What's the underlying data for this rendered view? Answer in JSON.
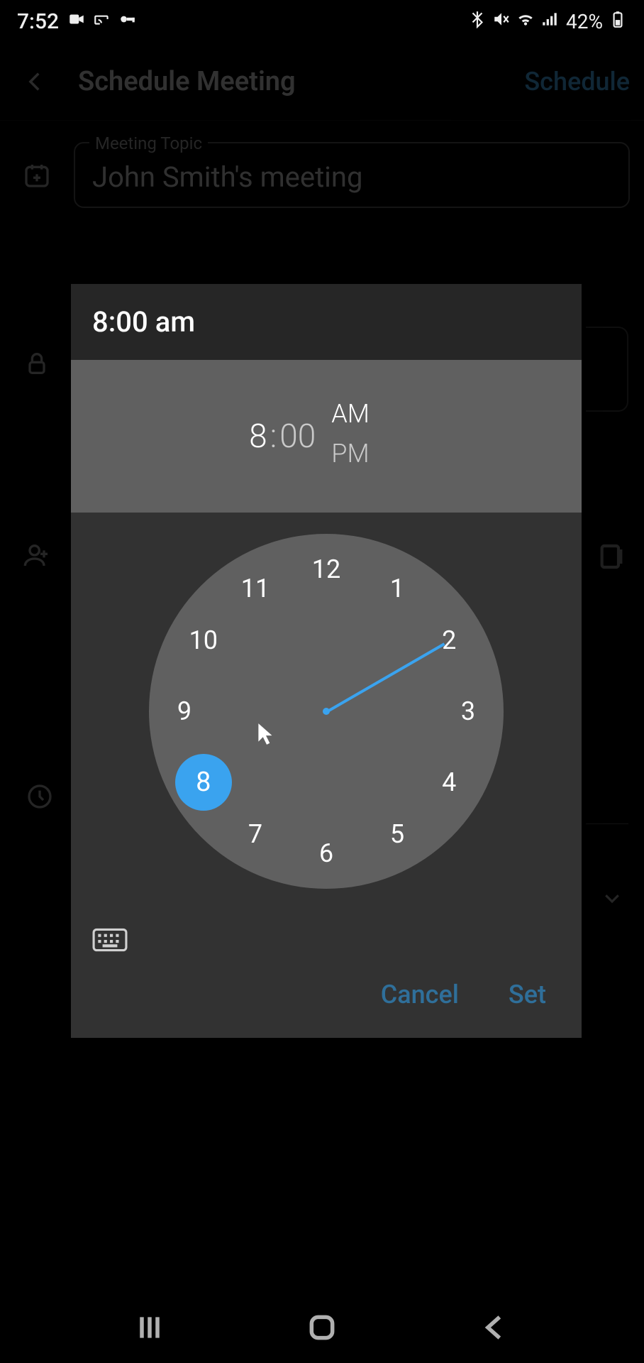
{
  "status": {
    "time": "7:52",
    "battery": "42%"
  },
  "header": {
    "title": "Schedule Meeting",
    "action": "Schedule"
  },
  "topic": {
    "label": "Meeting Topic",
    "value": "John Smith's meeting"
  },
  "timepicker": {
    "title": "8:00 am",
    "hour": "8",
    "sep": ":",
    "minute": "00",
    "am": "AM",
    "pm": "PM",
    "selected_hour": 8,
    "hours": [
      "12",
      "1",
      "2",
      "3",
      "4",
      "5",
      "6",
      "7",
      "8",
      "9",
      "10",
      "11"
    ],
    "cancel": "Cancel",
    "set": "Set"
  }
}
